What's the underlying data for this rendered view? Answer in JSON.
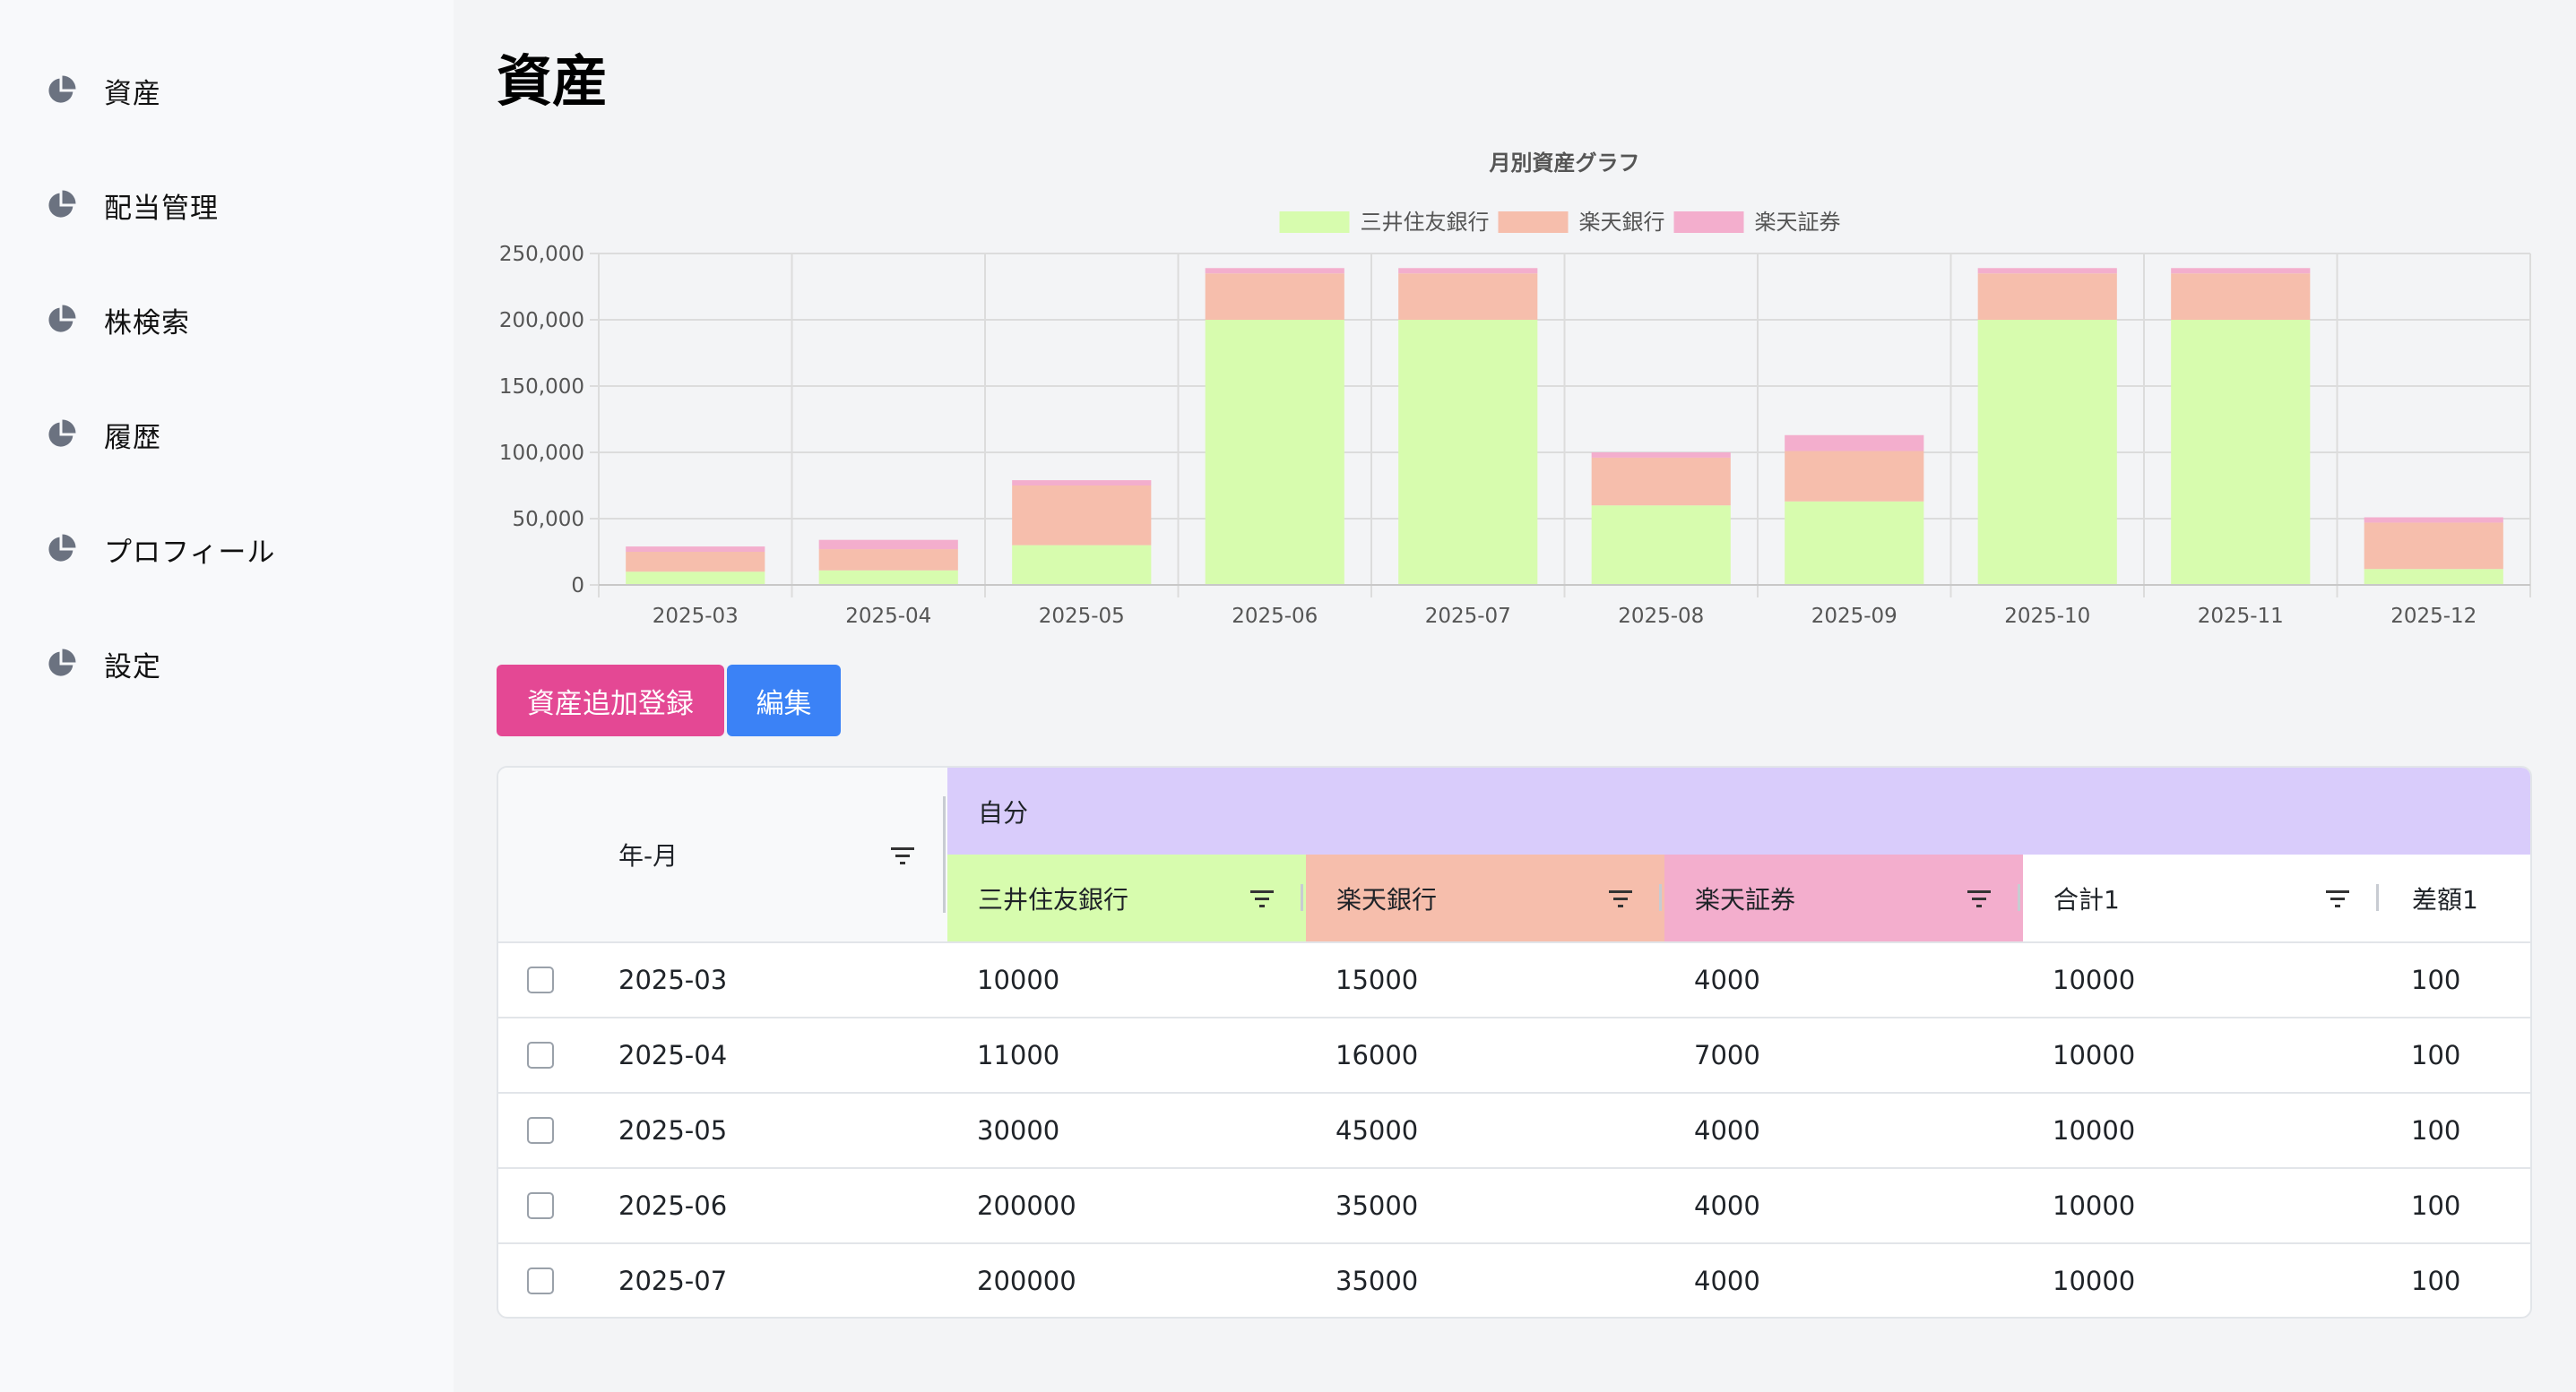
{
  "sidebar": {
    "items": [
      {
        "label": "資産",
        "icon": "pie-chart-icon"
      },
      {
        "label": "配当管理",
        "icon": "pie-chart-icon"
      },
      {
        "label": "株検索",
        "icon": "pie-chart-icon"
      },
      {
        "label": "履歴",
        "icon": "pie-chart-icon"
      },
      {
        "label": "プロフィール",
        "icon": "pie-chart-icon"
      },
      {
        "label": "設定",
        "icon": "pie-chart-icon"
      }
    ]
  },
  "page": {
    "title": "資産"
  },
  "chart_data": {
    "type": "bar",
    "stacked": true,
    "title": "月別資産グラフ",
    "categories": [
      "2025-03",
      "2025-04",
      "2025-05",
      "2025-06",
      "2025-07",
      "2025-08",
      "2025-09",
      "2025-10",
      "2025-11",
      "2025-12"
    ],
    "series": [
      {
        "name": "三井住友銀行",
        "color": "#d7fcae",
        "values": [
          10000,
          11000,
          30000,
          200000,
          200000,
          60000,
          63000,
          200000,
          200000,
          12000
        ]
      },
      {
        "name": "楽天銀行",
        "color": "#f6beac",
        "values": [
          15000,
          16000,
          45000,
          35000,
          35000,
          36000,
          38000,
          35000,
          35000,
          35000
        ]
      },
      {
        "name": "楽天証券",
        "color": "#f3aecd",
        "values": [
          4000,
          7000,
          4000,
          4000,
          4000,
          4000,
          12000,
          4000,
          4000,
          4000
        ]
      }
    ],
    "ylim": [
      0,
      250000
    ],
    "yticks": [
      "0",
      "50,000",
      "100,000",
      "150,000",
      "200,000",
      "250,000"
    ],
    "grid": true,
    "legend_position": "top"
  },
  "buttons": {
    "add": "資産追加登録",
    "edit": "編集"
  },
  "table": {
    "group_header": "自分",
    "columns": [
      {
        "label": "年-月",
        "color": "#f8f9fa"
      },
      {
        "label": "三井住友銀行",
        "color": "#d7fcae"
      },
      {
        "label": "楽天銀行",
        "color": "#f6beac"
      },
      {
        "label": "楽天証券",
        "color": "#f3aecd"
      },
      {
        "label": "合計1",
        "color": "#ffffff"
      },
      {
        "label": "差額1",
        "color": "#ffffff"
      }
    ],
    "rows": [
      [
        "2025-03",
        "10000",
        "15000",
        "4000",
        "10000",
        "100"
      ],
      [
        "2025-04",
        "11000",
        "16000",
        "7000",
        "10000",
        "100"
      ],
      [
        "2025-05",
        "30000",
        "45000",
        "4000",
        "10000",
        "100"
      ],
      [
        "2025-06",
        "200000",
        "35000",
        "4000",
        "10000",
        "100"
      ],
      [
        "2025-07",
        "200000",
        "35000",
        "4000",
        "10000",
        "100"
      ]
    ]
  }
}
